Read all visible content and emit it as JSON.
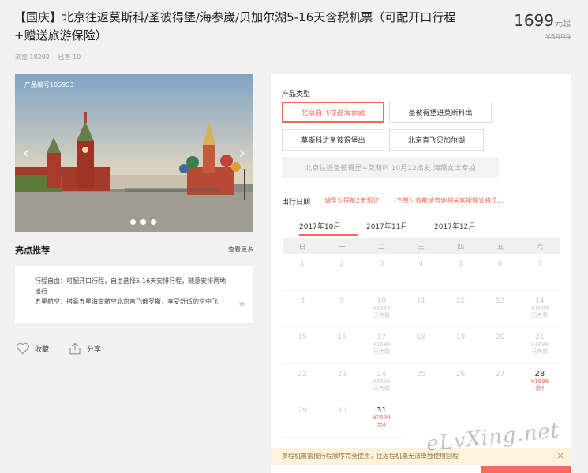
{
  "title": "【国庆】北京往返莫斯科/圣彼得堡/海参崴/贝加尔湖5-16天含税机票（可配开口行程+赠送旅游保险）",
  "price": {
    "current": "1699",
    "unit": "元起",
    "original": "¥5999"
  },
  "stats": {
    "views": "浏览 18292",
    "sold": "已售 10"
  },
  "hero": {
    "product_no": "产品编号105953",
    "prev": "‹",
    "next": "›"
  },
  "highlights": {
    "title": "亮点推荐",
    "more": "查看更多",
    "lines": [
      "行程自由：可配开口行程，自由选择5-16天安排行程，随意安排两地出行",
      "五星航空：搭乘五星海南航空北京直飞俄罗斯，享受舒适的空中飞"
    ],
    "quote": "❞"
  },
  "actions": {
    "favorite": "收藏",
    "share": "分享"
  },
  "product_types": {
    "label": "产品类型",
    "options": [
      "北京直飞往返海参崴",
      "圣彼得堡进莫斯科出",
      "莫斯科进圣彼得堡出",
      "北京直飞贝加尔湖",
      "北京往返圣彼得堡+莫斯科 10月12出发 海燕女士专拍"
    ]
  },
  "travel_date": {
    "label": "出行日期",
    "hint1": "请至少提前2天预订",
    "hint2": "(下单付款前请咨询相关客服确认机位..."
  },
  "months": [
    "2017年10月",
    "2017年11月",
    "2017年12月"
  ],
  "weekdays": [
    "日",
    "一",
    "二",
    "三",
    "四",
    "五",
    "六"
  ],
  "calendar": [
    {
      "d": "1"
    },
    {
      "d": "2"
    },
    {
      "d": "3"
    },
    {
      "d": "4"
    },
    {
      "d": "5"
    },
    {
      "d": "6"
    },
    {
      "d": "7"
    },
    {
      "d": "8"
    },
    {
      "d": "9"
    },
    {
      "d": "10",
      "p": "¥1699",
      "s": "已售罄"
    },
    {
      "d": "11"
    },
    {
      "d": "12"
    },
    {
      "d": "13"
    },
    {
      "d": "14",
      "p": "¥1699",
      "s": "已售罄"
    },
    {
      "d": "15"
    },
    {
      "d": "16"
    },
    {
      "d": "17",
      "p": "¥1699",
      "s": "已售罄"
    },
    {
      "d": "18"
    },
    {
      "d": "19"
    },
    {
      "d": "20"
    },
    {
      "d": "21",
      "p": "¥1699",
      "s": "已售罄"
    },
    {
      "d": "22"
    },
    {
      "d": "23"
    },
    {
      "d": "24",
      "p": "¥1699",
      "s": "已售罄"
    },
    {
      "d": "25"
    },
    {
      "d": "26"
    },
    {
      "d": "27"
    },
    {
      "d": "28",
      "p": "¥1699",
      "s": "余4",
      "avail": true
    },
    {
      "d": "29"
    },
    {
      "d": "30"
    },
    {
      "d": "31",
      "p": "¥1699",
      "s": "余4",
      "avail": true
    }
  ],
  "notice": "多程机票需按行程顺序完全使用，往返程机票无法单独使用回程",
  "watermark": "eLvXing.net",
  "colors": {
    "accent": "#f26b5b"
  }
}
